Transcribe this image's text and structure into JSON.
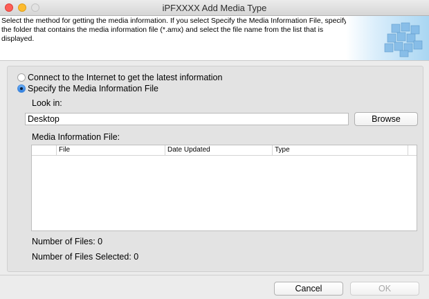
{
  "window": {
    "title": "iPFXXXX Add Media Type"
  },
  "header": {
    "description": "Select the method for getting the media information. If you select Specify the Media Information File, specify the folder that contains the media information file (*.amx) and select the file name from the list that is displayed."
  },
  "options": {
    "internet_label": "Connect to the Internet to get the latest information",
    "internet_selected": false,
    "file_label": "Specify the Media Information File",
    "file_selected": true
  },
  "look_in": {
    "label": "Look in:",
    "value": "Desktop",
    "browse_label": "Browse"
  },
  "media_file": {
    "label": "Media Information File:",
    "columns": [
      "File",
      "Date Updated",
      "Type"
    ]
  },
  "counts": {
    "files_text": "Number of Files: 0",
    "selected_text": "Number of Files Selected: 0"
  },
  "footer": {
    "cancel_label": "Cancel",
    "ok_label": "OK"
  },
  "colors": {
    "window_bg": "#ececec",
    "panel_bg": "#e3e3e3",
    "radio_selected": "#2f7fe0",
    "close_button": "#fd5f57",
    "minimize_button": "#fdbb2e"
  }
}
